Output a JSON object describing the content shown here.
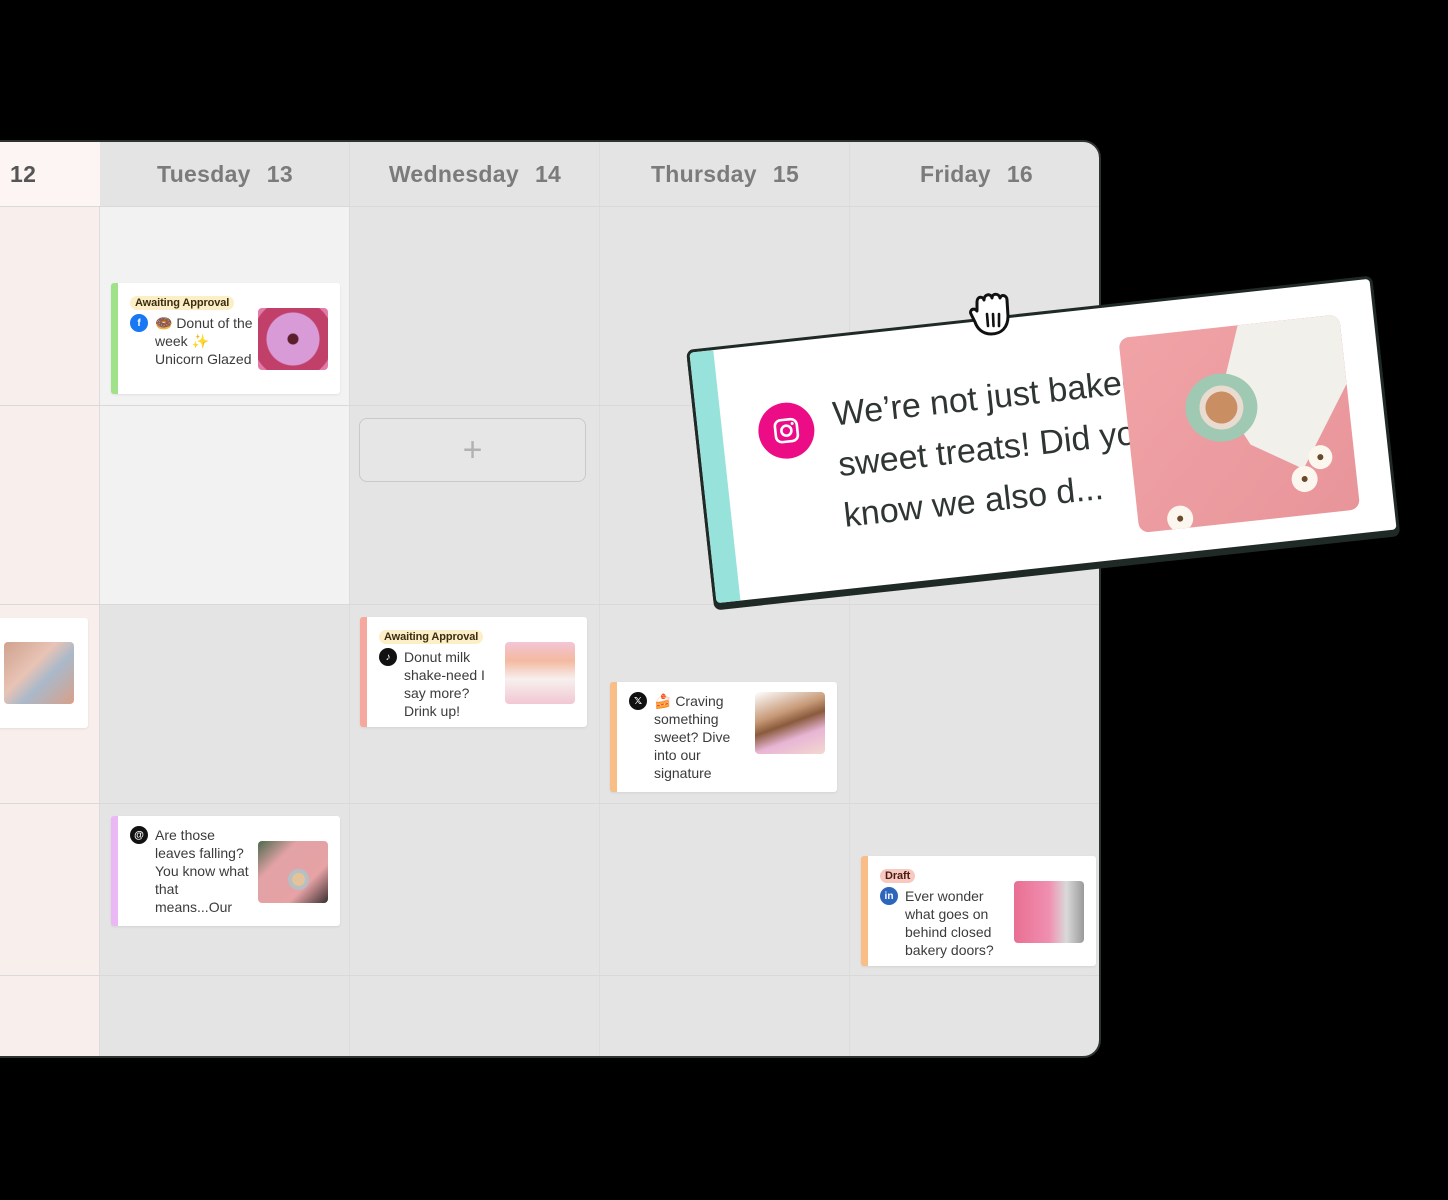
{
  "calendar": {
    "days": [
      {
        "name": "",
        "date": "12"
      },
      {
        "name": "Tuesday",
        "date": "13"
      },
      {
        "name": "Wednesday",
        "date": "14"
      },
      {
        "name": "Thursday",
        "date": "15"
      },
      {
        "name": "Friday",
        "date": "16"
      }
    ],
    "add_slot_label": "+"
  },
  "posts": [
    {
      "day": "Tuesday 13",
      "status": "Awaiting Approval",
      "platform": "facebook",
      "text": "🍩 Donut of the week ✨ Unicorn Glazed",
      "accent": "#9fe28a",
      "thumb": "pink donut with sprinkles"
    },
    {
      "day": "Wednesday 14",
      "status": "Awaiting Approval",
      "platform": "tiktok",
      "text": "Donut milk shake-need I say more? Drink up!",
      "accent": "#f6a89e",
      "thumb": "milkshakes with donuts"
    },
    {
      "day": "Thursday 15",
      "status": "",
      "platform": "x",
      "text": "🍰 Craving something sweet? Dive into our signature",
      "accent": "#f9bd88",
      "thumb": "box of donuts"
    },
    {
      "day": "Tuesday 13",
      "status": "",
      "platform": "threads",
      "text": "Are those leaves falling? You know what that means...Our",
      "accent": "#eab8f5",
      "thumb": "latte on pink table"
    },
    {
      "day": "Friday 16",
      "status": "Draft",
      "platform": "linkedin",
      "text": "Ever wonder what goes on behind closed bakery doors?",
      "accent": "#f9bd88",
      "thumb": "pink bakery interior"
    },
    {
      "day": "12",
      "status": "",
      "platform": "",
      "text": "",
      "accent": "",
      "thumb": "sprinkled donut"
    }
  ],
  "dragged_post": {
    "platform": "instagram",
    "text": "We’re not just baked sweet treats! Did you know we also d...",
    "accent": "#97e3dc",
    "thumb": "coffee cup on pink with flowers"
  },
  "cursor": "grab-hand-icon",
  "colors": {
    "facebook": "#1877f2",
    "tiktok": "#111111",
    "x": "#111111",
    "threads": "#111111",
    "linkedin": "#2d64bc",
    "instagram": "#ec0c86"
  }
}
